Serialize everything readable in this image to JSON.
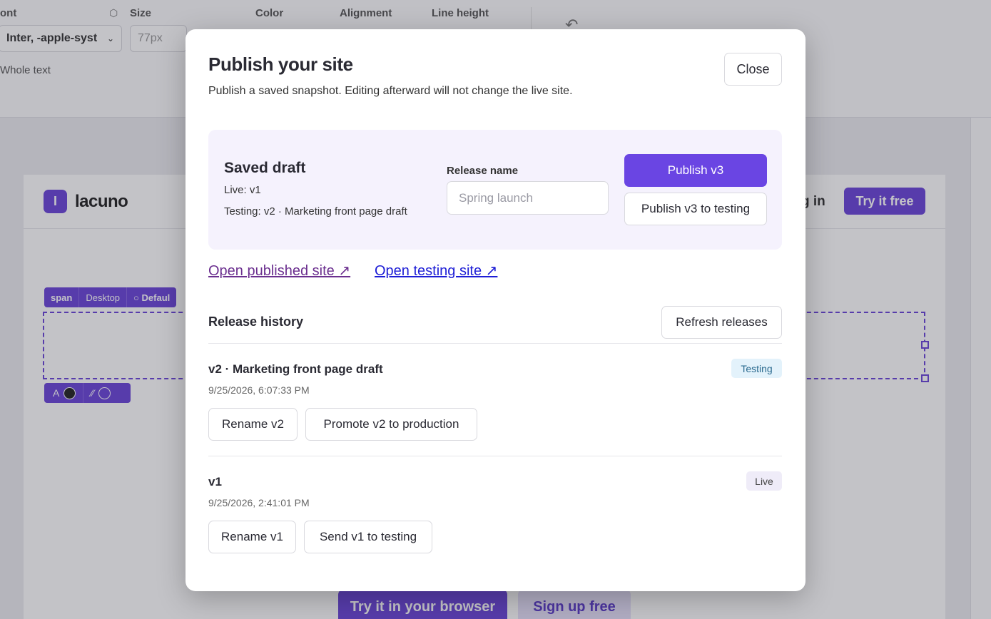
{
  "toolbar": {
    "font_label": "ont",
    "font_value": "Inter, -apple-syst",
    "size_label": "Size",
    "size_value": "77px",
    "color_label": "Color",
    "alignment_label": "Alignment",
    "line_height_label": "Line height",
    "scope_text": "Whole text"
  },
  "site": {
    "logo_letter": "I",
    "logo_name": "lacuno",
    "login_label": "g in",
    "try_free_label": "Try it free",
    "selection_tag": "span",
    "selection_breakpoint": "Desktop",
    "selection_state": "Defaul",
    "cta_primary": "Try it in your browser",
    "cta_secondary": "Sign up free"
  },
  "modal": {
    "title": "Publish your site",
    "subtitle": "Publish a saved snapshot. Editing afterward will not change the live site.",
    "close_label": "Close",
    "draft": {
      "title": "Saved draft",
      "live": "Live: v1",
      "testing": "Testing: v2 · Marketing front page draft",
      "release_name_label": "Release name",
      "release_name_placeholder": "Spring launch",
      "publish_label": "Publish v3",
      "publish_testing_label": "Publish v3 to testing"
    },
    "links": {
      "published": "Open published site ↗",
      "testing": "Open testing site ↗"
    },
    "history": {
      "title": "Release history",
      "refresh_label": "Refresh releases",
      "releases": [
        {
          "name": "v2 · Marketing front page draft",
          "date": "9/25/2026, 6:07:33 PM",
          "badge": "Testing",
          "actions": [
            "Rename v2",
            "Promote v2 to production"
          ]
        },
        {
          "name": "v1",
          "date": "9/25/2026, 2:41:01 PM",
          "badge": "Live",
          "actions": [
            "Rename v1",
            "Send v1 to testing"
          ]
        }
      ]
    }
  },
  "colors": {
    "accent": "#6a45e3",
    "testing_badge_bg": "#e3f2fb",
    "testing_badge_fg": "#2a6a8f",
    "live_badge_bg": "#efecf8",
    "live_badge_fg": "#444"
  }
}
